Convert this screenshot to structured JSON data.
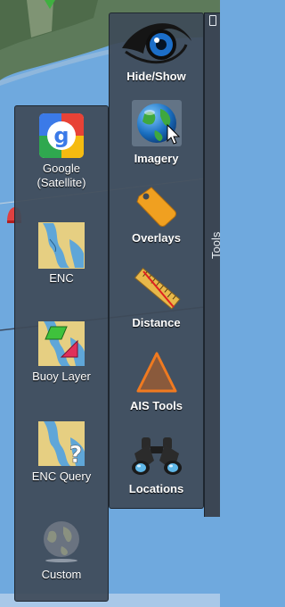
{
  "main_toolbar": {
    "items": [
      {
        "label": "Hide/Show",
        "icon": "eye-icon"
      },
      {
        "label": "Imagery",
        "icon": "globe-icon",
        "selected": true
      },
      {
        "label": "Overlays",
        "icon": "tag-icon"
      },
      {
        "label": "Distance",
        "icon": "ruler-icon"
      },
      {
        "label": "AIS Tools",
        "icon": "triangle-icon"
      },
      {
        "label": "Locations",
        "icon": "binoculars-icon"
      }
    ]
  },
  "imagery_submenu": {
    "items": [
      {
        "label": "Google (Satellite)",
        "icon": "google-icon"
      },
      {
        "label": "ENC",
        "icon": "enc-chart-icon"
      },
      {
        "label": "Buoy Layer",
        "icon": "buoy-layer-icon"
      },
      {
        "label": "ENC Query",
        "icon": "enc-query-icon"
      },
      {
        "label": "Custom",
        "icon": "custom-globe-icon"
      }
    ]
  },
  "tools_panel": {
    "label": "Tools"
  },
  "colors": {
    "panel": "#3e4a58",
    "water": "#6fa9de",
    "accent_orange": "#e8862a"
  }
}
